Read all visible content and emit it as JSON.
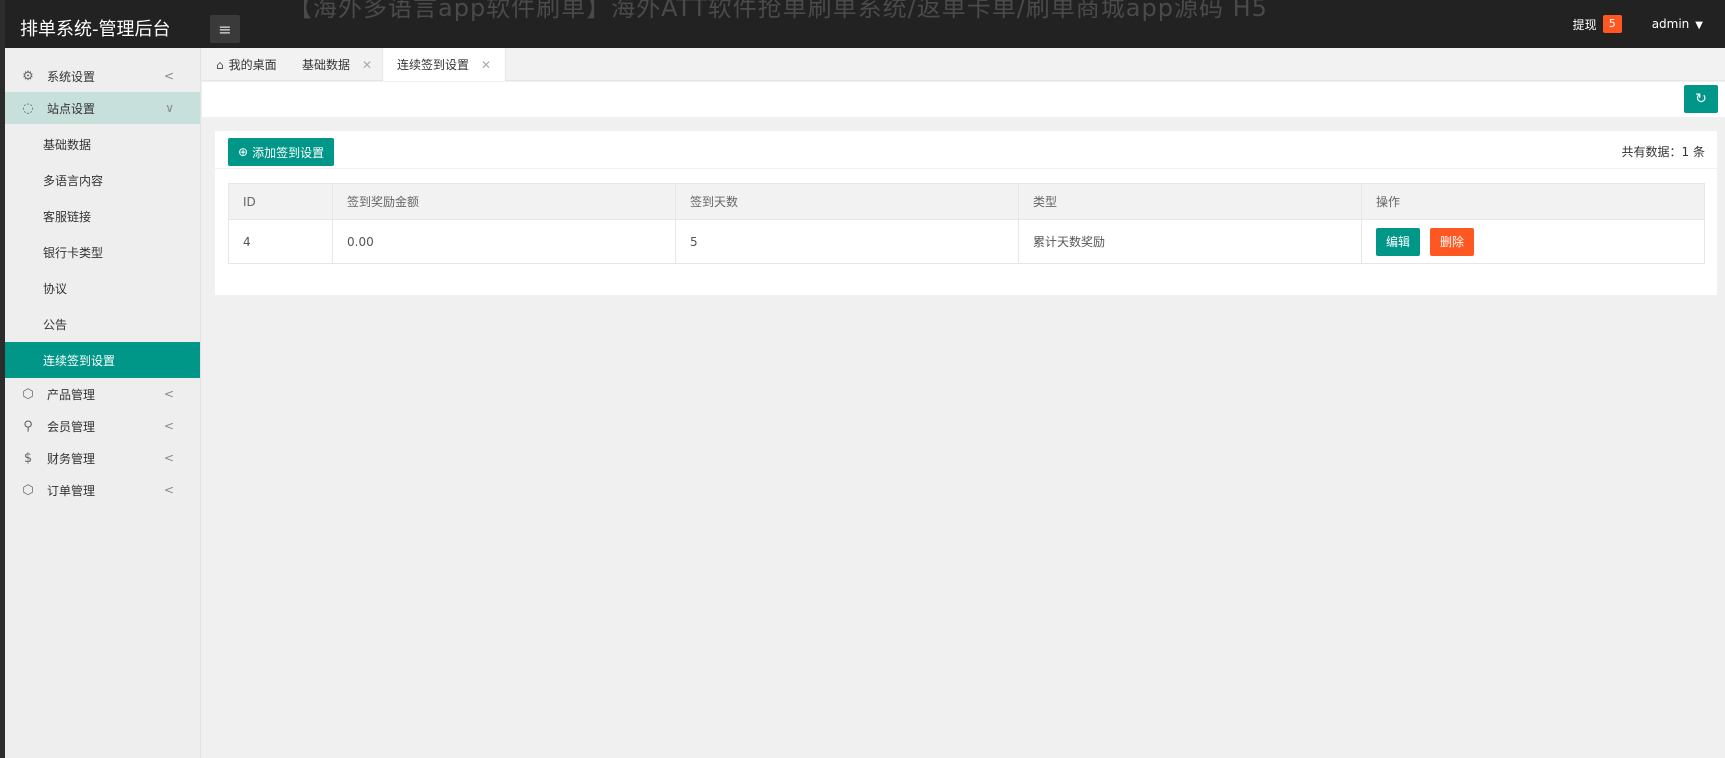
{
  "app": {
    "brand": "排单系统-管理后台",
    "overlay_text": "【海外多语言app软件刷单】海外ATT软件抢单刷单系统/返单卡单/刷单商城app源码 H5"
  },
  "header": {
    "menu_toggle_icon": "hamburger-icon",
    "withdraw_label": "提现",
    "withdraw_count": "5",
    "user": "admin"
  },
  "sidebar": {
    "groups": [
      {
        "label": "系统设置",
        "icon": "gear-icon",
        "arrow": "<"
      },
      {
        "label": "站点设置",
        "icon": "site-icon",
        "arrow": "∨"
      }
    ],
    "sub_items": [
      {
        "label": "基础数据"
      },
      {
        "label": "多语言内容"
      },
      {
        "label": "客服链接"
      },
      {
        "label": "银行卡类型"
      },
      {
        "label": "协议"
      },
      {
        "label": "公告"
      },
      {
        "label": "连续签到设置"
      }
    ],
    "groups_after": [
      {
        "label": "产品管理",
        "icon": "box-icon",
        "arrow": "<"
      },
      {
        "label": "会员管理",
        "icon": "user-icon",
        "arrow": "<"
      },
      {
        "label": "财务管理",
        "icon": "dollar-icon",
        "arrow": "<"
      },
      {
        "label": "订单管理",
        "icon": "box-icon",
        "arrow": "<"
      }
    ]
  },
  "tabs": [
    {
      "label": "我的桌面"
    },
    {
      "label": "基础数据"
    },
    {
      "label": "连续签到设置"
    }
  ],
  "toolbar": {
    "refresh_icon": "refresh-icon"
  },
  "card": {
    "add_button": "添加签到设置",
    "total_text": "共有数据：1 条"
  },
  "table": {
    "headers": [
      "ID",
      "签到奖励金额",
      "签到天数",
      "类型",
      "操作"
    ],
    "rows": [
      {
        "id": "4",
        "amount": "0.00",
        "days": "5",
        "type": "累计天数奖励",
        "edit": "编辑",
        "delete": "删除"
      }
    ]
  }
}
